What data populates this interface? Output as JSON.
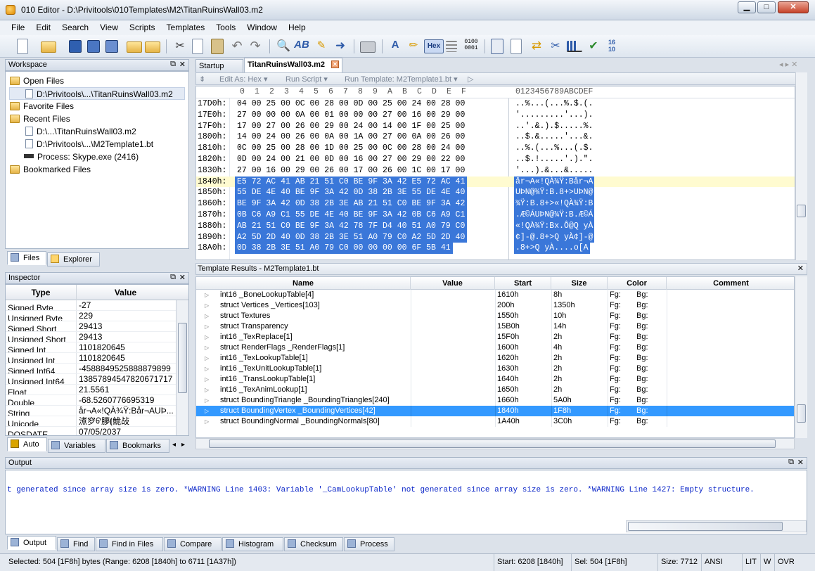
{
  "window": {
    "title": "010 Editor - D:\\Privitools\\010Templates\\M2\\TitanRuinsWall03.m2",
    "minimize": "▁",
    "maximize": "□",
    "close": "✕"
  },
  "menu": [
    "File",
    "Edit",
    "Search",
    "View",
    "Scripts",
    "Templates",
    "Tools",
    "Window",
    "Help"
  ],
  "toolbar": {
    "hex_label": "Hex"
  },
  "workspace": {
    "title": "Workspace",
    "open_files": "Open Files",
    "open_file_1": "D:\\Privitools\\...\\TitanRuinsWall03.m2",
    "favorite_files": "Favorite Files",
    "recent_files": "Recent Files",
    "recent_1": "D:\\...\\TitanRuinsWall03.m2",
    "recent_2": "D:\\Privitools\\...\\M2Template1.bt",
    "recent_3": "Process: Skype.exe (2416)",
    "bookmarked": "Bookmarked Files",
    "tab_files": "Files",
    "tab_explorer": "Explorer"
  },
  "inspector": {
    "title": "Inspector",
    "col_type": "Type",
    "col_value": "Value",
    "rows": [
      {
        "type": "Signed Byte",
        "value": "-27"
      },
      {
        "type": "Unsigned Byte",
        "value": "229"
      },
      {
        "type": "Signed Short",
        "value": "29413"
      },
      {
        "type": "Unsigned Short",
        "value": "29413"
      },
      {
        "type": "Signed Int",
        "value": "1101820645"
      },
      {
        "type": "Unsigned Int",
        "value": "1101820645"
      },
      {
        "type": "Signed Int64",
        "value": "-4588849525888879899"
      },
      {
        "type": "Unsigned Int64",
        "value": "13857894547820671717"
      },
      {
        "type": "Float",
        "value": "21.5561"
      },
      {
        "type": "Double",
        "value": "-68.5260776695319"
      },
      {
        "type": "String",
        "value": "år¬A«!QÀ¾Ÿ:Bår¬AUÞ..."
      },
      {
        "type": "Unicode",
        "value": "㵭穸ᠪ䑅⦗鮠敁"
      },
      {
        "type": "DOSDATE",
        "value": "07/05/2037"
      }
    ],
    "tab_auto": "Auto",
    "tab_variables": "Variables",
    "tab_bookmarks": "Bookmarks"
  },
  "editor": {
    "tab_startup": "Startup",
    "tab_file": "TitanRuinsWall03.m2",
    "edit_as": "Edit As: Hex ▾",
    "run_script": "Run Script ▾",
    "run_template": "Run Template: M2Template1.bt ▾",
    "col_header": "0  1  2  3  4  5  6  7  8  9  A  B  C  D  E  F",
    "col_header_text": "0123456789ABCDEF",
    "rows": [
      {
        "addr": "17D0h:",
        "hex": "04 00 25 00 0C 00 28 00 0D 00 25 00 24 00 28 00",
        "text": "..%...(...%.$.(.",
        "sel": false
      },
      {
        "addr": "17E0h:",
        "hex": "27 00 00 00 0A 00 01 00 00 00 27 00 16 00 29 00",
        "text": "'.........'...).",
        "sel": false
      },
      {
        "addr": "17F0h:",
        "hex": "17 00 27 00 26 00 29 00 24 00 14 00 1F 00 25 00",
        "text": "..'.&.).$.....%.",
        "sel": false
      },
      {
        "addr": "1800h:",
        "hex": "14 00 24 00 26 00 0A 00 1A 00 27 00 0A 00 26 00",
        "text": "..$.&.....'...&.",
        "sel": false
      },
      {
        "addr": "1810h:",
        "hex": "0C 00 25 00 28 00 1D 00 25 00 0C 00 28 00 24 00",
        "text": "..%.(...%...(.$.",
        "sel": false
      },
      {
        "addr": "1820h:",
        "hex": "0D 00 24 00 21 00 0D 00 16 00 27 00 29 00 22 00",
        "text": "..$.!.....'.).\".",
        "sel": false
      },
      {
        "addr": "1830h:",
        "hex": "27 00 16 00 29 00 26 00 17 00 26 00 1C 00 17 00",
        "text": "'...).&...&.....",
        "sel": false
      },
      {
        "addr": "1840h:",
        "hex": "E5 72 AC 41 AB 21 51 C0 BE 9F 3A 42 E5 72 AC 41",
        "text": "år¬A«!QÀ¾Ÿ:Bår¬A",
        "sel": true
      },
      {
        "addr": "1850h:",
        "hex": "55 DE 4E 40 BE 9F 3A 42 0D 38 2B 3E 55 DE 4E 40",
        "text": "UÞN@¾Ÿ:B.8+>UÞN@",
        "sel": true
      },
      {
        "addr": "1860h:",
        "hex": "BE 9F 3A 42 0D 38 2B 3E AB 21 51 C0 BE 9F 3A 42",
        "text": "¾Ÿ:B.8+>«!QÀ¾Ÿ:B",
        "sel": true
      },
      {
        "addr": "1870h:",
        "hex": "0B C6 A9 C1 55 DE 4E 40 BE 9F 3A 42 0B C6 A9 C1",
        "text": ".Æ©ÁUÞN@¾Ÿ:B.Æ©Á",
        "sel": true
      },
      {
        "addr": "1880h:",
        "hex": "AB 21 51 C0 BE 9F 3A 42 78 7F D4 40 51 A0 79 C0",
        "text": "«!QÀ¾Ÿ:Bx.Ô@Q yÀ",
        "sel": true
      },
      {
        "addr": "1890h:",
        "hex": "A2 5D 2D 40 0D 38 2B 3E 51 A0 79 C0 A2 5D 2D 40",
        "text": "¢]-@.8+>Q yÀ¢]-@",
        "sel": true
      },
      {
        "addr": "18A0h:",
        "hex": "0D 38 2B 3E 51 A0 79 C0 00 00 00 00 6F 5B 41",
        "text": ".8+>Q yÀ....o[A",
        "sel": true
      }
    ]
  },
  "template_results": {
    "title": "Template Results - M2Template1.bt",
    "cols": {
      "name": "Name",
      "value": "Value",
      "start": "Start",
      "size": "Size",
      "color": "Color",
      "comment": "Comment"
    },
    "rows": [
      {
        "name": "int16 _BoneLookupTable[4]",
        "start": "1610h",
        "size": "8h",
        "fg": "Fg:",
        "bg": "Bg:",
        "selected": false
      },
      {
        "name": "struct Vertices _Vertices[103]",
        "start": "200h",
        "size": "1350h",
        "fg": "Fg:",
        "bg": "Bg:",
        "selected": false
      },
      {
        "name": "struct Textures",
        "start": "1550h",
        "size": "10h",
        "fg": "Fg:",
        "bg": "Bg:",
        "selected": false
      },
      {
        "name": "struct Transparency",
        "start": "15B0h",
        "size": "14h",
        "fg": "Fg:",
        "bg": "Bg:",
        "selected": false
      },
      {
        "name": "int16 _TexReplace[1]",
        "start": "15F0h",
        "size": "2h",
        "fg": "Fg:",
        "bg": "Bg:",
        "selected": false
      },
      {
        "name": "struct RenderFlags _RenderFlags[1]",
        "start": "1600h",
        "size": "4h",
        "fg": "Fg:",
        "bg": "Bg:",
        "selected": false
      },
      {
        "name": "int16 _TexLookupTable[1]",
        "start": "1620h",
        "size": "2h",
        "fg": "Fg:",
        "bg": "Bg:",
        "selected": false
      },
      {
        "name": "int16 _TexUnitLookupTable[1]",
        "start": "1630h",
        "size": "2h",
        "fg": "Fg:",
        "bg": "Bg:",
        "selected": false
      },
      {
        "name": "int16 _TransLookupTable[1]",
        "start": "1640h",
        "size": "2h",
        "fg": "Fg:",
        "bg": "Bg:",
        "selected": false
      },
      {
        "name": "int16 _TexAnimLookup[1]",
        "start": "1650h",
        "size": "2h",
        "fg": "Fg:",
        "bg": "Bg:",
        "selected": false
      },
      {
        "name": "struct BoundingTriangle _BoundingTriangles[240]",
        "start": "1660h",
        "size": "5A0h",
        "fg": "Fg:",
        "bg": "Bg:",
        "selected": false
      },
      {
        "name": "struct BoundingVertex _BoundingVertices[42]",
        "start": "1840h",
        "size": "1F8h",
        "fg": "Fg:",
        "bg": "Bg:",
        "selected": true
      },
      {
        "name": "struct BoundingNormal _BoundingNormals[80]",
        "start": "1A40h",
        "size": "3C0h",
        "fg": "Fg:",
        "bg": "Bg:",
        "selected": false
      }
    ]
  },
  "output": {
    "title": "Output",
    "text": "t generated since array size is zero. *WARNING Line 1403: Variable '_CamLookupTable' not generated since array size is zero. *WARNING Line 1427: Empty structure.",
    "tabs": [
      "Output",
      "Find",
      "Find in Files",
      "Compare",
      "Histogram",
      "Checksum",
      "Process"
    ]
  },
  "status": {
    "selection": "Selected: 504 [1F8h] bytes (Range: 6208 [1840h] to 6711 [1A37h])",
    "start": "Start: 6208 [1840h]",
    "sel": "Sel: 504 [1F8h]",
    "size": "Size: 7712",
    "encoding": "ANSI",
    "lit": "LIT",
    "w": "W",
    "ovr": "OVR"
  }
}
